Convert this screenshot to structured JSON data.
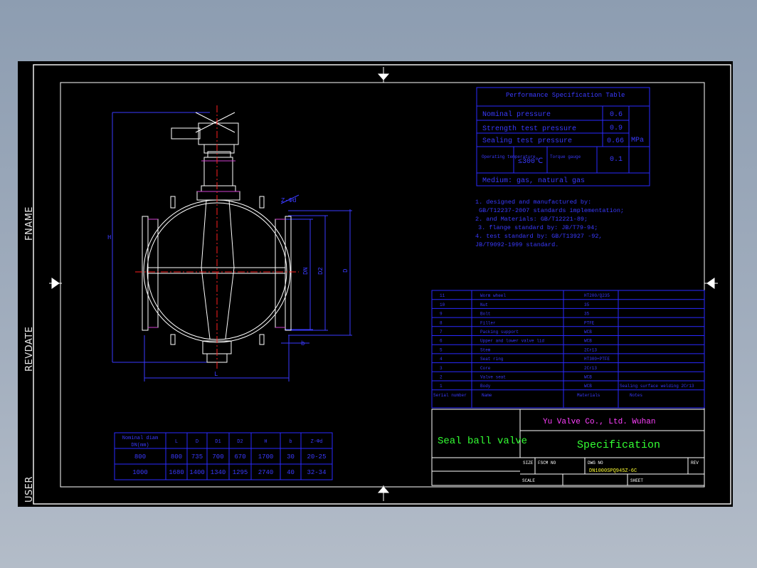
{
  "side_labels": {
    "fname": "FNAME",
    "revdate": "REVDATE",
    "user": "USER"
  },
  "perf_table": {
    "title": "Performance Specification Table",
    "rows": [
      {
        "label": "Nominal pressure",
        "value": "0.6"
      },
      {
        "label": "Strength test pressure",
        "value": "0.9"
      },
      {
        "label": "Sealing test pressure",
        "value": "0.66"
      }
    ],
    "unit": "MPa",
    "operating_label": "Operating temperature",
    "operating_value": "≤300℃",
    "torque_label": "Torque gauge",
    "torque_value": "0.1",
    "medium": "Medium: gas, natural gas"
  },
  "notes": [
    "1. designed and manufactured by:",
    "GB/T12237-2007 standards implementation;",
    "2. and Materials: GB/T12221-89;",
    "3. flange standard by: JB/T79-94;",
    "4. test standard by: GB/T13927 -92,",
    "JB/T9092-1999 standard."
  ],
  "drawing_labels": {
    "h": "H",
    "dn": "DN",
    "d2": "D2",
    "d": "D",
    "nd": "Z-Φd",
    "b": "b",
    "l": "L"
  },
  "bom": {
    "rows": [
      {
        "no": "11",
        "name": "Worm wheel",
        "material": "HT200/Q235"
      },
      {
        "no": "10",
        "name": "Nut",
        "material": "35"
      },
      {
        "no": "9",
        "name": "Bolt",
        "material": "35"
      },
      {
        "no": "8",
        "name": "Filler",
        "material": "PTFE"
      },
      {
        "no": "7",
        "name": "Packing support",
        "material": "WCB"
      },
      {
        "no": "6",
        "name": "Upper and lower valve lid",
        "material": "WCB"
      },
      {
        "no": "5",
        "name": "Stem",
        "material": "2Cr13"
      },
      {
        "no": "4",
        "name": "Seat ring",
        "material": "HT300+PTFE"
      },
      {
        "no": "3",
        "name": "Core",
        "material": "2Cr13"
      },
      {
        "no": "2",
        "name": "Valve seat",
        "material": "WCB"
      },
      {
        "no": "1",
        "name": "Body",
        "material": "WCB"
      }
    ],
    "body_note": "Sealing surface welding 2Cr13",
    "header": {
      "no": "Serial number",
      "name": "Name",
      "material": "Materials",
      "note": "Notes"
    }
  },
  "dims_table": {
    "headers": [
      "Nominal diam DN(mm)",
      "L",
      "D",
      "D1",
      "D2",
      "H",
      "b",
      "Z-Φd"
    ],
    "rows": [
      [
        "800",
        "800",
        "735",
        "700",
        "670",
        "1700",
        "30",
        "20-25"
      ],
      [
        "1000",
        "1680",
        "1400",
        "1340",
        "1295",
        "2740",
        "40",
        "32-34"
      ]
    ]
  },
  "title_block": {
    "company": "Yu Valve Co., Ltd. Wuhan",
    "product": "Seal ball valve",
    "doc_title": "Specification",
    "size_label": "SIZE",
    "fscm_label": "FSCM NO",
    "dwg_label": "DWG NO",
    "dwg_value": "DN1000SPQ945Z-6C",
    "rev_label": "REV",
    "scale_label": "SCALE",
    "sheet_label": "SHEET"
  },
  "colors": {
    "border": "#ffffff",
    "table_lines": "#2a2aff",
    "table_text": "#3a3aff",
    "company": "#ff40ff",
    "accent_green": "#33ff33",
    "dwg_yellow": "#ffff33",
    "centerline": "#ff2020"
  }
}
